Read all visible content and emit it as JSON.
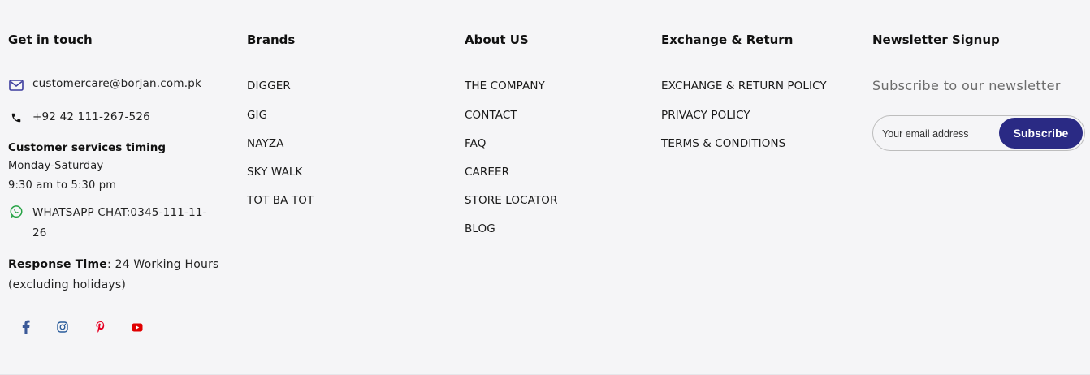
{
  "colors": {
    "background": "#f5f5f7",
    "subscribe_button": "#2a2a84",
    "facebook": "#3b5998",
    "instagram": "#2a5c9c",
    "pinterest": "#e60023",
    "youtube": "#e00000",
    "whatsapp": "#25a244",
    "mail_icon": "#3d3d9e"
  },
  "get_in_touch": {
    "heading": "Get in touch",
    "email": "customercare@borjan.com.pk",
    "phone": "+92 42 111-267-526",
    "timing_title": "Customer services timing",
    "timing_days": "Monday-Saturday",
    "timing_hours": "9:30 am to 5:30 pm",
    "whatsapp_line1": "WHATSAPP CHAT:0345-111-11-",
    "whatsapp_line2": "26",
    "response_label": "Response Time",
    "response_value": ": 24 Working Hours (excluding holidays)",
    "icons": {
      "email": "mail-icon",
      "phone": "phone-icon",
      "whatsapp": "whatsapp-icon"
    },
    "social_icons": [
      "facebook-icon",
      "instagram-icon",
      "pinterest-icon",
      "youtube-icon"
    ]
  },
  "brands": {
    "heading": "Brands",
    "items": [
      "DIGGER",
      "GIG",
      "NAYZA",
      "SKY WALK",
      "TOT BA TOT"
    ]
  },
  "about": {
    "heading": "About US",
    "items": [
      "THE COMPANY",
      "CONTACT",
      "FAQ",
      "CAREER",
      "STORE LOCATOR",
      "BLOG"
    ]
  },
  "exchange": {
    "heading": "Exchange & Return",
    "items": [
      "EXCHANGE & RETURN POLICY",
      "PRIVACY POLICY",
      "TERMS & CONDITIONS"
    ]
  },
  "newsletter": {
    "heading": "Newsletter Signup",
    "subtitle": "Subscribe to our newsletter",
    "email_placeholder": "Your email address",
    "email_value": "",
    "subscribe_label": "Subscribe"
  }
}
